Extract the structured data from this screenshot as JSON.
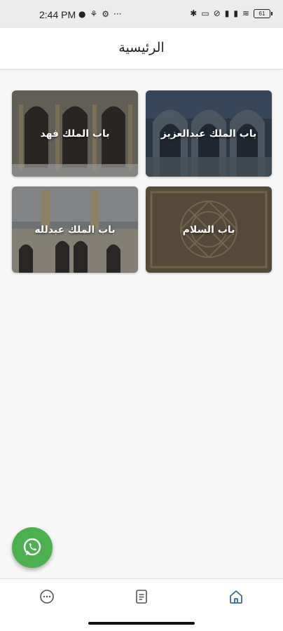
{
  "status_bar": {
    "time": "2:44 PM",
    "battery": "61"
  },
  "app_bar": {
    "title": "الرئيسية"
  },
  "tiles": [
    {
      "label": "باب الملك عبدالعزيز"
    },
    {
      "label": "باب الملك فهد"
    },
    {
      "label": "باب السلام"
    },
    {
      "label": "باب الملك عبدلله"
    }
  ],
  "colors": {
    "fab": "#4caf50",
    "active_nav": "#2e6da4",
    "inactive_nav": "#555555"
  },
  "icons": {
    "fab": "whatsapp-icon",
    "nav": [
      "chat-icon",
      "document-icon",
      "home-icon"
    ]
  }
}
